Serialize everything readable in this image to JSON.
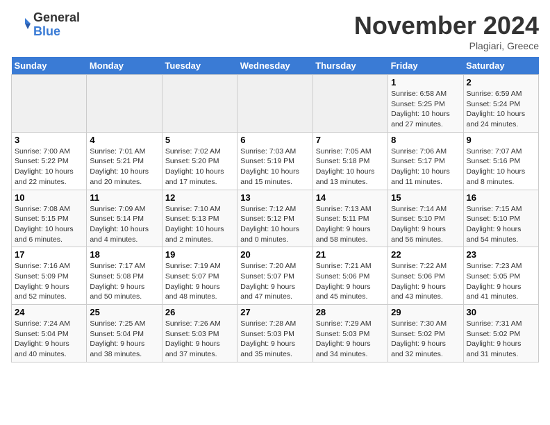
{
  "logo": {
    "general": "General",
    "blue": "Blue"
  },
  "title": "November 2024",
  "subtitle": "Plagiari, Greece",
  "days_header": [
    "Sunday",
    "Monday",
    "Tuesday",
    "Wednesday",
    "Thursday",
    "Friday",
    "Saturday"
  ],
  "weeks": [
    [
      {
        "day": "",
        "info": ""
      },
      {
        "day": "",
        "info": ""
      },
      {
        "day": "",
        "info": ""
      },
      {
        "day": "",
        "info": ""
      },
      {
        "day": "",
        "info": ""
      },
      {
        "day": "1",
        "info": "Sunrise: 6:58 AM\nSunset: 5:25 PM\nDaylight: 10 hours\nand 27 minutes."
      },
      {
        "day": "2",
        "info": "Sunrise: 6:59 AM\nSunset: 5:24 PM\nDaylight: 10 hours\nand 24 minutes."
      }
    ],
    [
      {
        "day": "3",
        "info": "Sunrise: 7:00 AM\nSunset: 5:22 PM\nDaylight: 10 hours\nand 22 minutes."
      },
      {
        "day": "4",
        "info": "Sunrise: 7:01 AM\nSunset: 5:21 PM\nDaylight: 10 hours\nand 20 minutes."
      },
      {
        "day": "5",
        "info": "Sunrise: 7:02 AM\nSunset: 5:20 PM\nDaylight: 10 hours\nand 17 minutes."
      },
      {
        "day": "6",
        "info": "Sunrise: 7:03 AM\nSunset: 5:19 PM\nDaylight: 10 hours\nand 15 minutes."
      },
      {
        "day": "7",
        "info": "Sunrise: 7:05 AM\nSunset: 5:18 PM\nDaylight: 10 hours\nand 13 minutes."
      },
      {
        "day": "8",
        "info": "Sunrise: 7:06 AM\nSunset: 5:17 PM\nDaylight: 10 hours\nand 11 minutes."
      },
      {
        "day": "9",
        "info": "Sunrise: 7:07 AM\nSunset: 5:16 PM\nDaylight: 10 hours\nand 8 minutes."
      }
    ],
    [
      {
        "day": "10",
        "info": "Sunrise: 7:08 AM\nSunset: 5:15 PM\nDaylight: 10 hours\nand 6 minutes."
      },
      {
        "day": "11",
        "info": "Sunrise: 7:09 AM\nSunset: 5:14 PM\nDaylight: 10 hours\nand 4 minutes."
      },
      {
        "day": "12",
        "info": "Sunrise: 7:10 AM\nSunset: 5:13 PM\nDaylight: 10 hours\nand 2 minutes."
      },
      {
        "day": "13",
        "info": "Sunrise: 7:12 AM\nSunset: 5:12 PM\nDaylight: 10 hours\nand 0 minutes."
      },
      {
        "day": "14",
        "info": "Sunrise: 7:13 AM\nSunset: 5:11 PM\nDaylight: 9 hours\nand 58 minutes."
      },
      {
        "day": "15",
        "info": "Sunrise: 7:14 AM\nSunset: 5:10 PM\nDaylight: 9 hours\nand 56 minutes."
      },
      {
        "day": "16",
        "info": "Sunrise: 7:15 AM\nSunset: 5:10 PM\nDaylight: 9 hours\nand 54 minutes."
      }
    ],
    [
      {
        "day": "17",
        "info": "Sunrise: 7:16 AM\nSunset: 5:09 PM\nDaylight: 9 hours\nand 52 minutes."
      },
      {
        "day": "18",
        "info": "Sunrise: 7:17 AM\nSunset: 5:08 PM\nDaylight: 9 hours\nand 50 minutes."
      },
      {
        "day": "19",
        "info": "Sunrise: 7:19 AM\nSunset: 5:07 PM\nDaylight: 9 hours\nand 48 minutes."
      },
      {
        "day": "20",
        "info": "Sunrise: 7:20 AM\nSunset: 5:07 PM\nDaylight: 9 hours\nand 47 minutes."
      },
      {
        "day": "21",
        "info": "Sunrise: 7:21 AM\nSunset: 5:06 PM\nDaylight: 9 hours\nand 45 minutes."
      },
      {
        "day": "22",
        "info": "Sunrise: 7:22 AM\nSunset: 5:06 PM\nDaylight: 9 hours\nand 43 minutes."
      },
      {
        "day": "23",
        "info": "Sunrise: 7:23 AM\nSunset: 5:05 PM\nDaylight: 9 hours\nand 41 minutes."
      }
    ],
    [
      {
        "day": "24",
        "info": "Sunrise: 7:24 AM\nSunset: 5:04 PM\nDaylight: 9 hours\nand 40 minutes."
      },
      {
        "day": "25",
        "info": "Sunrise: 7:25 AM\nSunset: 5:04 PM\nDaylight: 9 hours\nand 38 minutes."
      },
      {
        "day": "26",
        "info": "Sunrise: 7:26 AM\nSunset: 5:03 PM\nDaylight: 9 hours\nand 37 minutes."
      },
      {
        "day": "27",
        "info": "Sunrise: 7:28 AM\nSunset: 5:03 PM\nDaylight: 9 hours\nand 35 minutes."
      },
      {
        "day": "28",
        "info": "Sunrise: 7:29 AM\nSunset: 5:03 PM\nDaylight: 9 hours\nand 34 minutes."
      },
      {
        "day": "29",
        "info": "Sunrise: 7:30 AM\nSunset: 5:02 PM\nDaylight: 9 hours\nand 32 minutes."
      },
      {
        "day": "30",
        "info": "Sunrise: 7:31 AM\nSunset: 5:02 PM\nDaylight: 9 hours\nand 31 minutes."
      }
    ]
  ]
}
